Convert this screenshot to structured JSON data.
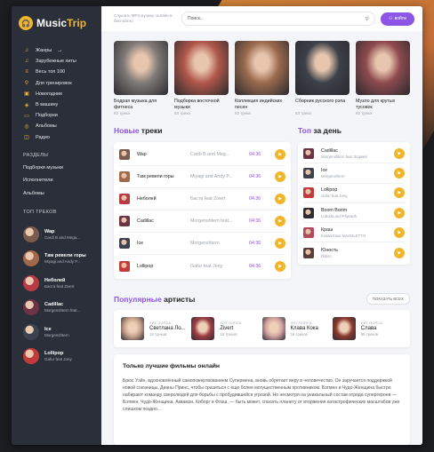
{
  "logo": {
    "icon": "headphones-icon",
    "text_a": "Music",
    "text_b": "Trip"
  },
  "header": {
    "description": "Слушать MP3 музыку онлайн и бесплатно",
    "search_placeholder": "Поиск...",
    "login": "войти"
  },
  "sidebar": {
    "nav": [
      {
        "label": "Жанры",
        "icon": "music-note-icon",
        "arrow": "→"
      },
      {
        "label": "Зарубежные хиты",
        "icon": "music-note-icon"
      },
      {
        "label": "Весь топ 100",
        "icon": "list-icon"
      },
      {
        "label": "Для тренировок",
        "icon": "dumbbell-icon"
      },
      {
        "label": "Новогодние",
        "icon": "gift-icon"
      },
      {
        "label": "В машину",
        "icon": "car-icon"
      },
      {
        "label": "Подборки",
        "icon": "folder-icon"
      },
      {
        "label": "Альбомы",
        "icon": "album-icon"
      },
      {
        "label": "Радио",
        "icon": "radio-icon"
      }
    ],
    "sections_head": "РАЗДЕЛЫ",
    "sections": [
      "Подборки музыки",
      "Исполнители",
      "Альбомы"
    ],
    "top_head": "ТОП ТРЕКОВ",
    "top_tracks": [
      {
        "title": "Wap",
        "artist": "Cardi B and Mega...",
        "color": "#7a5c4e"
      },
      {
        "title": "Там ревели горы",
        "artist": "Miyagi and Andy P...",
        "color": "#a0694a"
      },
      {
        "title": "Неболей",
        "artist": "Баста feat Zivert",
        "color": "#b73b44"
      },
      {
        "title": "Cadillac",
        "artist": "Morgenshtern feat...",
        "color": "#6b3344"
      },
      {
        "title": "Ice",
        "artist": "Morgenshtern",
        "color": "#3d4250"
      },
      {
        "title": "Lollipop",
        "artist": "Gafur feat Jony",
        "color": "#c23b3b"
      }
    ]
  },
  "playlists": [
    {
      "title": "Бодрая музыка для фитнеса",
      "count": "63 трека",
      "color": "#7f7a78"
    },
    {
      "title": "Подборка восточной музыки",
      "count": "63 трека",
      "color": "#b0574a"
    },
    {
      "title": "Коллекция индийских песен",
      "count": "63 трека",
      "color": "#9a6a4d"
    },
    {
      "title": "Сборник русского рэпа",
      "count": "63 трека",
      "color": "#3c4048"
    },
    {
      "title": "Музло для крутых тусовок",
      "count": "63 трека",
      "color": "#8e4a4f"
    }
  ],
  "new_tracks": {
    "title_a": "Новые",
    "title_b": " треки",
    "rows": [
      {
        "title": "Wap",
        "artist": "Cardi B and Meg...",
        "time": "04:36",
        "color": "#7a5c4e"
      },
      {
        "title": "Там ревели горы",
        "artist": "Miyagi and Andy P...",
        "time": "04:36",
        "color": "#a0694a"
      },
      {
        "title": "Неболей",
        "artist": "Баста feat Zivert",
        "time": "04:36",
        "color": "#b73b44"
      },
      {
        "title": "Cadillac",
        "artist": "Morgenshtern feat...",
        "time": "04:36",
        "color": "#6b3344"
      },
      {
        "title": "Ice",
        "artist": "Morgenshtern",
        "time": "04:36",
        "color": "#3d4250"
      },
      {
        "title": "Lollipop",
        "artist": "Gafur feat Jony",
        "time": "04:36",
        "color": "#c23b3b"
      }
    ]
  },
  "top_day": {
    "title_a": "Топ",
    "title_b": " за день",
    "rows": [
      {
        "title": "Cadillac",
        "artist": "Morgenshtern feat Элджей",
        "color": "#6b3344"
      },
      {
        "title": "Ice",
        "artist": "Morgenshtern",
        "color": "#3d4250"
      },
      {
        "title": "Lollipop",
        "artist": "Gafur feat Jony",
        "color": "#c23b3b"
      },
      {
        "title": "Boom Boom",
        "artist": "Loboda and Pharaoh",
        "color": "#2e2b33"
      },
      {
        "title": "Краш",
        "artist": "Клава Кока feat NILETTO",
        "color": "#b34a5c"
      },
      {
        "title": "Юность",
        "artist": "Dabro",
        "color": "#5a3d3a"
      }
    ]
  },
  "artists": {
    "title_a": "Популярные",
    "title_b": " артисты",
    "show_all": "ПОКАЗАТЬ ВСЕХ",
    "items": [
      {
        "label": "ХИТ-ПОПСА",
        "name": "Светлана Ло...",
        "count": "18 треков",
        "color": "#c9a48d"
      },
      {
        "label": "ХИТ-ПОПСА",
        "name": "Zivert",
        "count": "18 треков",
        "color": "#9c3d44"
      },
      {
        "label": "ХИТ-ПОПСА",
        "name": "Клава Кока",
        "count": "18 треков",
        "color": "#d3a3a3"
      },
      {
        "label": "ХИТ-ПОПСА",
        "name": "Слава",
        "count": "55 треков",
        "color": "#8a3a2e"
      }
    ]
  },
  "films": {
    "title": "Только лучшие фильмы онлайн",
    "text": "Брюс Уэйн, вдохновлённый самопожертвованием Супермена, вновь обретает веру в человечество. Он заручается поддержкой новой союзницы, Дианы Принс, чтобы сразиться с еще более могущественным противником. Бэтмен и Чудо-Женщина быстро набирают команду сверхлюдей для борьбы с пробудившейся угрозой. Но несмотря на уникальный состав отряда супергероев — Бэтмен, Чудо-Женщина, Аквамэн, Киборг и Флэш, — быть может, спасать планету от вторжения катастрофических масштабов уже слишком поздно..."
  }
}
